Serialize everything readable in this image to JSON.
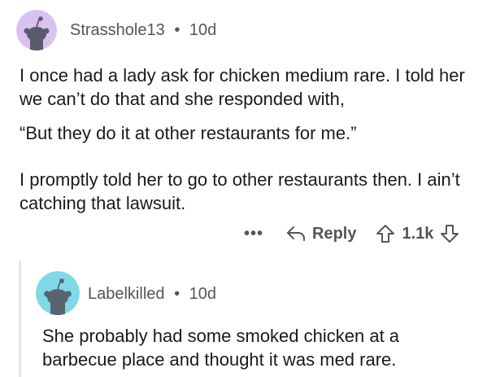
{
  "comment": {
    "username": "Strasshole13",
    "separator": "•",
    "age": "10d",
    "paragraphs": [
      "I once had a lady ask for chicken medium rare. I told her we can’t do that and she responded with,",
      "“But they do it at other restaurants for me.”",
      "I promptly told her to go to other restaurants then. I ain’t catching that lawsuit."
    ],
    "actions": {
      "more_label": "•••",
      "reply_label": "Reply",
      "score": "1.1k"
    }
  },
  "reply": {
    "username": "Labelkilled",
    "separator": "•",
    "age": "10d",
    "text": "She probably had some smoked chicken at a barbecue place and thought it was med rare."
  },
  "colors": {
    "avatar1_bg": "#d9c2f0",
    "avatar2_bg": "#7fd9e6",
    "snoo": "#5a5a6e",
    "meta_text": "#555555",
    "thread_line": "#e6e6e6"
  }
}
